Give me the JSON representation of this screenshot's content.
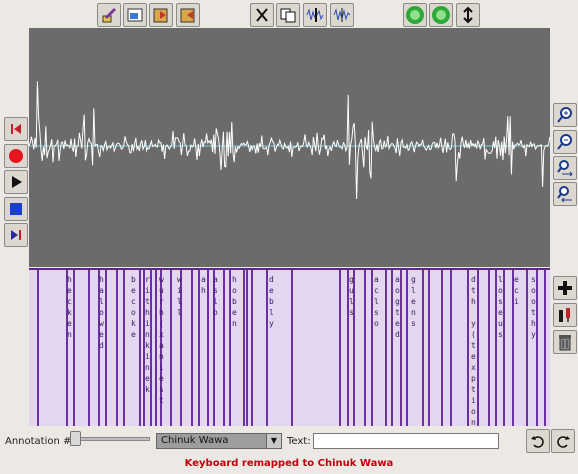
{
  "annotation": {
    "number_label": "Annotation #:",
    "language_selected": "Chinuk Wawa",
    "text_label": "Text:",
    "text_value": ""
  },
  "status_message": "Keyboard remapped to Chinuk Wawa",
  "icons": {
    "top_left": [
      "edit-pencil-icon",
      "image-icon",
      "book-export-icon",
      "book-import-icon"
    ],
    "top_middle": [
      "cut-icon",
      "copy-icon",
      "split-waveform-icon",
      "join-waveform-icon"
    ],
    "top_right": [
      "green-circle-icon",
      "green-circle-icon",
      "vertical-resize-icon"
    ],
    "left_transport": [
      "skip-to-start-icon",
      "record-icon",
      "play-icon",
      "stop-icon",
      "skip-to-end-icon"
    ],
    "right_zoom": [
      "zoom-in-icon",
      "zoom-out-icon",
      "zoom-horizontal-in-icon",
      "zoom-horizontal-out-icon"
    ],
    "right_tools": [
      "add-icon",
      "tools-icon",
      "trash-icon"
    ],
    "bottom_right": [
      "undo-icon",
      "redo-icon"
    ]
  },
  "annotation_segments": [
    "hecken",
    "halowed",
    "becoke",
    "rithinkinek",
    "wurh(xaniest",
    "will",
    "ah",
    "aslo",
    "hoben",
    "debly",
    "guls",
    "aclso",
    "aogted",
    "glens",
    "dth y(texption)",
    "loseus",
    "eci",
    "soothy"
  ],
  "colors": {
    "waveform_bg": "#6b6b6b",
    "annotation_bg": "#e3d6ee",
    "segment_line": "#6a2fa0",
    "status_text": "#c0000a"
  }
}
